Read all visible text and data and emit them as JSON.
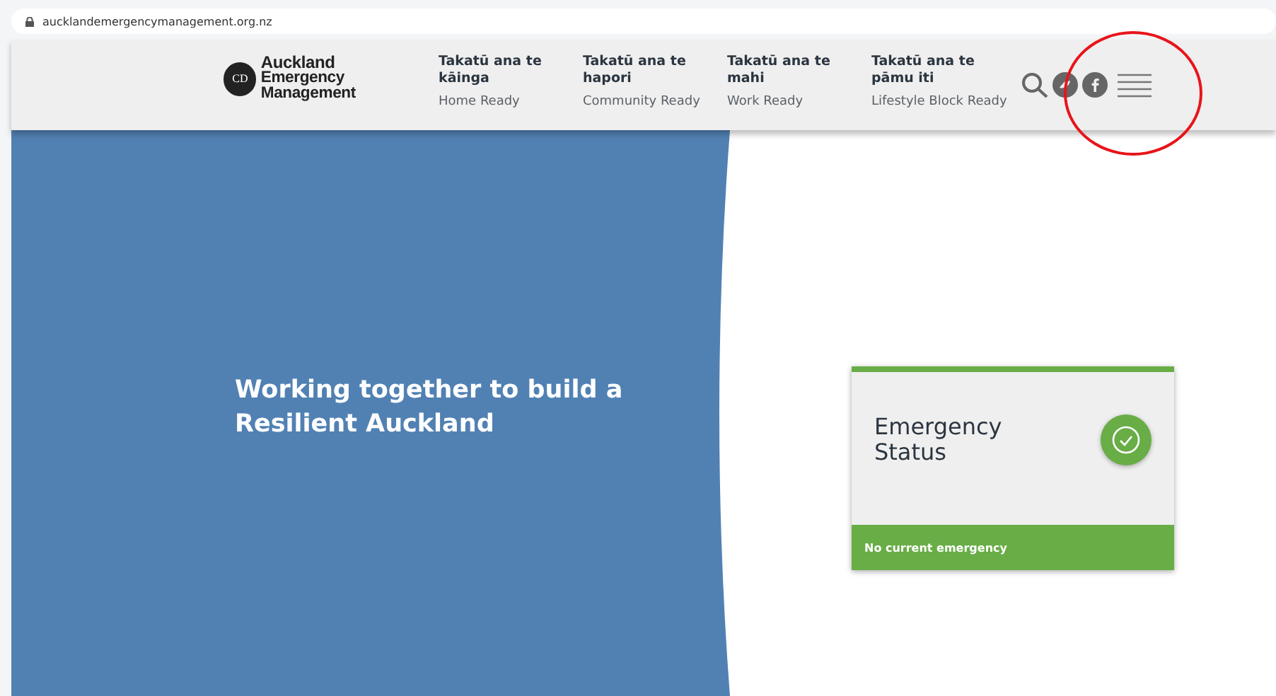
{
  "browser": {
    "url": "aucklandemergencymanagement.org.nz"
  },
  "logo": {
    "mark": "CD",
    "line_1": "Auckland",
    "line_2": "Emergency Management"
  },
  "nav": [
    {
      "title": "Takatū ana te kāinga",
      "subtitle": "Home Ready"
    },
    {
      "title": "Takatū ana te hapori",
      "subtitle": "Community Ready"
    },
    {
      "title": "Takatū ana te mahi",
      "subtitle": "Work Ready"
    },
    {
      "title": "Takatū ana te pāmu iti",
      "subtitle": "Lifestyle Block Ready"
    }
  ],
  "hero": {
    "headline": "Working together to build a Resilient Auckland"
  },
  "status_card": {
    "title": "Emergency Status",
    "message": "No current emergency",
    "active_emergency": false
  }
}
